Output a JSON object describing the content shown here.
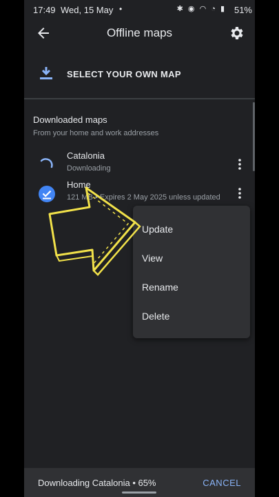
{
  "status_bar": {
    "time": "17:49",
    "date": "Wed, 15 May",
    "dot": "•",
    "icons": "✱ ◉ ◠ ◔ ▮",
    "battery": "51%"
  },
  "header": {
    "title": "Offline maps"
  },
  "select_map": {
    "label": "SELECT YOUR OWN MAP"
  },
  "downloaded": {
    "title": "Downloaded maps",
    "subtitle": "From your home and work addresses",
    "items": [
      {
        "name": "Catalonia",
        "meta": "Downloading",
        "icon": "loading-spinner-icon"
      },
      {
        "name": "Home",
        "meta": "121 MB • Expires 2 May 2025 unless updated",
        "icon": "check-circle-icon"
      }
    ]
  },
  "context_menu": {
    "items": [
      "Update",
      "View",
      "Rename",
      "Delete"
    ]
  },
  "bottom_bar": {
    "status": "Downloading Catalonia • 65%",
    "cancel_label": "CANCEL"
  },
  "colors": {
    "background": "#202124",
    "accent": "#8ab4f8",
    "arrow": "#f2e24a"
  }
}
